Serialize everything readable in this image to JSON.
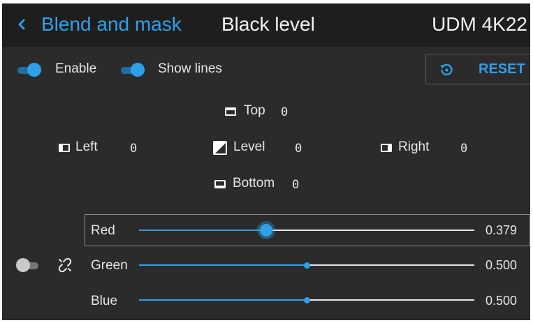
{
  "header": {
    "breadcrumb": "Blend and mask",
    "title": "Black level",
    "device": "UDM 4K22"
  },
  "toggles": {
    "enable": {
      "label": "Enable",
      "on": true
    },
    "show_lines": {
      "label": "Show lines",
      "on": true
    },
    "link": {
      "on": false
    }
  },
  "reset": {
    "label": "RESET"
  },
  "edges": {
    "top": {
      "label": "Top",
      "value": "0"
    },
    "left": {
      "label": "Left",
      "value": "0"
    },
    "level": {
      "label": "Level",
      "value": "0"
    },
    "right": {
      "label": "Right",
      "value": "0"
    },
    "bottom": {
      "label": "Bottom",
      "value": "0"
    }
  },
  "sliders": [
    {
      "label": "Red",
      "value": "0.379",
      "fraction": 0.379,
      "selected": true
    },
    {
      "label": "Green",
      "value": "0.500",
      "fraction": 0.5,
      "selected": false
    },
    {
      "label": "Blue",
      "value": "0.500",
      "fraction": 0.5,
      "selected": false
    }
  ],
  "colors": {
    "accent": "#2ea0e8",
    "background": "#2b2b2b",
    "header": "#1e1e1e",
    "text": "#e6e6e6"
  },
  "icons": {
    "back": "chevron-left-icon",
    "reset": "reset-icon",
    "link": "unlink-icon"
  }
}
